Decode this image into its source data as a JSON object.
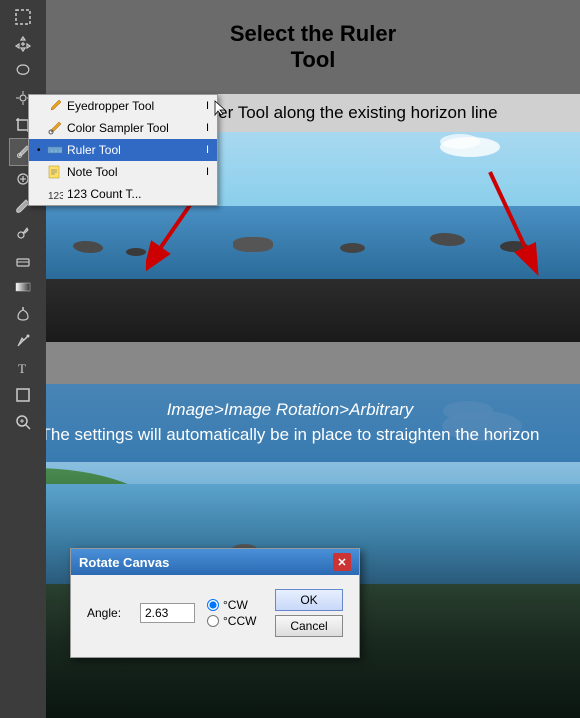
{
  "top_instruction": {
    "line1": "Select the Ruler",
    "line2": "Tool"
  },
  "toolbar": {
    "tools": [
      {
        "name": "marquee",
        "icon": "rect"
      },
      {
        "name": "move",
        "icon": "move"
      },
      {
        "name": "lasso",
        "icon": "lasso"
      },
      {
        "name": "magic-wand",
        "icon": "wand"
      },
      {
        "name": "crop",
        "icon": "crop"
      },
      {
        "name": "eyedropper-active",
        "icon": "eyedropper"
      },
      {
        "name": "healing",
        "icon": "heal"
      },
      {
        "name": "brush",
        "icon": "brush"
      },
      {
        "name": "clone",
        "icon": "clone"
      },
      {
        "name": "history",
        "icon": "history"
      },
      {
        "name": "eraser",
        "icon": "eraser"
      },
      {
        "name": "gradient",
        "icon": "gradient"
      },
      {
        "name": "dodge",
        "icon": "dodge"
      },
      {
        "name": "pen",
        "icon": "pen"
      },
      {
        "name": "type",
        "icon": "type"
      },
      {
        "name": "shape",
        "icon": "shape"
      },
      {
        "name": "3d",
        "icon": "3d"
      },
      {
        "name": "zoom",
        "icon": "zoom"
      }
    ]
  },
  "context_menu": {
    "items": [
      {
        "label": "Eyedropper Tool",
        "shortcut": "I",
        "dot": false,
        "icon": "eyedropper",
        "selected": false
      },
      {
        "label": "Color Sampler Tool",
        "shortcut": "I",
        "dot": false,
        "icon": "colorsampler",
        "selected": false
      },
      {
        "label": "Ruler Tool",
        "shortcut": "I",
        "dot": true,
        "icon": "ruler",
        "selected": true
      },
      {
        "label": "Note Tool",
        "shortcut": "I",
        "dot": false,
        "icon": "note",
        "selected": false
      },
      {
        "label": "123 Count T...",
        "shortcut": "",
        "dot": false,
        "icon": "count",
        "selected": false
      }
    ]
  },
  "middle_panel": {
    "instruction": "Run the Ruler Tool along the existing\nhorizon line"
  },
  "bottom_panel": {
    "instruction_italic": "Image>Image Rotation>Arbitrary",
    "instruction": "The settings will automatically be in place to\nstraighten the horizon"
  },
  "dialog": {
    "title": "Rotate Canvas",
    "close_label": "✕",
    "angle_label": "Angle:",
    "angle_value": "2.63",
    "cw_label": "°CW",
    "ccw_label": "°CCW",
    "ok_label": "OK",
    "cancel_label": "Cancel"
  }
}
